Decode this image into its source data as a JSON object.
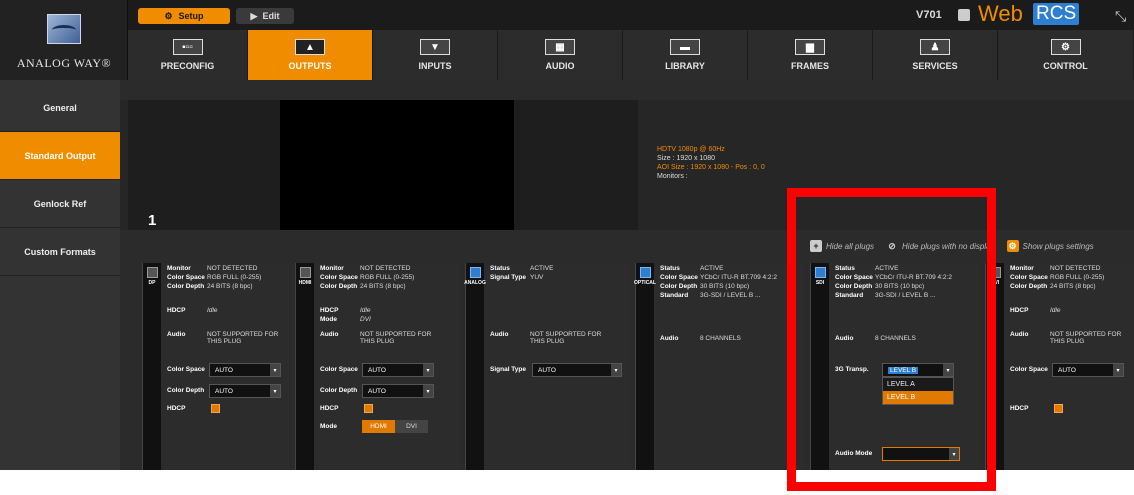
{
  "brand": {
    "logo_text": "ANALOG WAY®",
    "web": "Web",
    "rcs": "RCS",
    "version": "V701"
  },
  "modes": {
    "setup": "Setup",
    "edit": "Edit"
  },
  "nav": [
    {
      "label": "PRECONFIG",
      "icon": "preconfig-icon",
      "glyph": "▪▫▫"
    },
    {
      "label": "OUTPUTS",
      "icon": "outputs-icon",
      "glyph": "▲"
    },
    {
      "label": "INPUTS",
      "icon": "inputs-icon",
      "glyph": "▼"
    },
    {
      "label": "AUDIO",
      "icon": "audio-icon",
      "glyph": "▦"
    },
    {
      "label": "LIBRARY",
      "icon": "library-icon",
      "glyph": "▬"
    },
    {
      "label": "FRAMES",
      "icon": "frames-icon",
      "glyph": "▆"
    },
    {
      "label": "SERVICES",
      "icon": "services-icon",
      "glyph": "♟"
    },
    {
      "label": "CONTROL",
      "icon": "control-icon",
      "glyph": "⚙"
    }
  ],
  "sidebar": [
    {
      "label": "General"
    },
    {
      "label": "Standard Output"
    },
    {
      "label": "Genlock Ref"
    },
    {
      "label": "Custom Formats"
    }
  ],
  "preview": {
    "screen_number": "1",
    "format": "HDTV 1080p @ 60Hz",
    "size": "Size : 1920 x 1080",
    "aoi": "AOI Size : 1920 x 1080 - Pos : 0, 0",
    "monitors": "Monitors :"
  },
  "toolbar": {
    "hide_all": "Hide all plugs",
    "hide_no_display": "Hide plugs with no display",
    "show_settings": "Show plugs settings"
  },
  "plugs": {
    "dp": {
      "tab": "DP",
      "monitor_lbl": "Monitor",
      "monitor_val": "NOT DETECTED",
      "cs_lbl": "Color Space",
      "cs_val": "RGB FULL (0-255)",
      "cd_lbl": "Color Depth",
      "cd_val": "24 BITS (8 bpc)",
      "hdcp_lbl": "HDCP",
      "hdcp_val": "Idle",
      "audio_lbl": "Audio",
      "audio_val": "NOT SUPPORTED FOR THIS PLUG",
      "set_cs_lbl": "Color Space",
      "set_cs_val": "AUTO",
      "set_cd_lbl": "Color Depth",
      "set_cd_val": "AUTO",
      "set_hdcp_lbl": "HDCP"
    },
    "hdmi": {
      "tab": "HDMI",
      "monitor_lbl": "Monitor",
      "monitor_val": "NOT DETECTED",
      "cs_lbl": "Color Space",
      "cs_val": "RGB FULL (0-255)",
      "cd_lbl": "Color Depth",
      "cd_val": "24 BITS (8 bpc)",
      "hdcp_lbl": "HDCP",
      "hdcp_val": "Idle",
      "mode_lbl": "Mode",
      "mode_val": "DVI",
      "audio_lbl": "Audio",
      "audio_val": "NOT SUPPORTED FOR THIS PLUG",
      "set_cs_lbl": "Color Space",
      "set_cs_val": "AUTO",
      "set_cd_lbl": "Color Depth",
      "set_cd_val": "AUTO",
      "set_hdcp_lbl": "HDCP",
      "set_mode_lbl": "Mode",
      "opt_hdmi": "HDMI",
      "opt_dvi": "DVI"
    },
    "analog": {
      "tab": "ANALOG",
      "status_lbl": "Status",
      "status_val": "ACTIVE",
      "sig_lbl": "Signal Type",
      "sig_val": "YUV",
      "audio_lbl": "Audio",
      "audio_val": "NOT SUPPORTED FOR THIS PLUG",
      "set_sig_lbl": "Signal Type",
      "set_sig_val": "AUTO"
    },
    "optical": {
      "tab": "OPTICAL",
      "status_lbl": "Status",
      "status_val": "ACTIVE",
      "cs_lbl": "Color Space",
      "cs_val": "YCbCr ITU-R BT.709 4:2:2",
      "cd_lbl": "Color Depth",
      "cd_val": "30 BITS (10 bpc)",
      "std_lbl": "Standard",
      "std_val": "3G-SDI / LEVEL B ...",
      "audio_lbl": "Audio",
      "audio_val": "8 CHANNELS"
    },
    "sdi": {
      "tab": "SDI",
      "status_lbl": "Status",
      "status_val": "ACTIVE",
      "cs_lbl": "Color Space",
      "cs_val": "YCbCr ITU-R BT.709 4:2:2",
      "cd_lbl": "Color Depth",
      "cd_val": "30 BITS (10 bpc)",
      "std_lbl": "Standard",
      "std_val": "3G-SDI / LEVEL B ...",
      "audio_lbl": "Audio",
      "audio_val": "8 CHANNELS",
      "transp_lbl": "3G Transp.",
      "transp_val": "LEVEL B",
      "transp_options": [
        "LEVEL A",
        "LEVEL B"
      ],
      "audio_mode_lbl": "Audio Mode",
      "audio_mode_val": ""
    },
    "dvi": {
      "tab": "DVI",
      "monitor_lbl": "Monitor",
      "monitor_val": "NOT DETECTED",
      "cs_lbl": "Color Space",
      "cs_val": "RGB FULL (0-255)",
      "cd_lbl": "Color Depth",
      "cd_val": "24 BITS (8 bpc)",
      "hdcp_lbl": "HDCP",
      "hdcp_val": "Idle",
      "audio_lbl": "Audio",
      "audio_val": "NOT SUPPORTED FOR THIS PLUG",
      "set_cs_lbl": "Color Space",
      "set_cs_val": "AUTO",
      "set_hdcp_lbl": "HDCP"
    }
  },
  "colors": {
    "accent": "#f08c00",
    "highlight": "#ff0000",
    "brand_blue": "#2d7fd1"
  }
}
